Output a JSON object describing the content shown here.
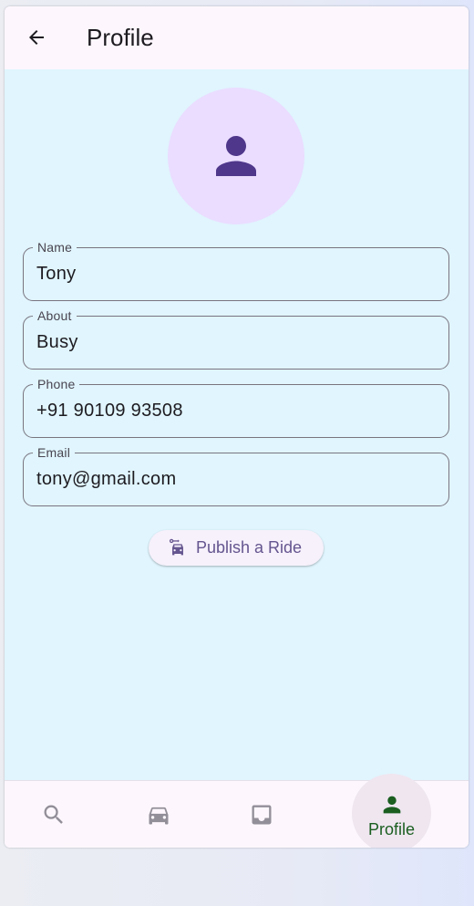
{
  "app_bar": {
    "title": "Profile"
  },
  "profile": {
    "fields": [
      {
        "label": "Name",
        "value": "Tony"
      },
      {
        "label": "About",
        "value": "Busy"
      },
      {
        "label": "Phone",
        "value": "+91 90109 93508"
      },
      {
        "label": "Email",
        "value": "tony@gmail.com"
      }
    ],
    "publish_button_label": "Publish a Ride"
  },
  "bottom_nav": {
    "items": [
      {
        "icon": "search-icon",
        "label": ""
      },
      {
        "icon": "car-icon",
        "label": ""
      },
      {
        "icon": "inbox-icon",
        "label": ""
      },
      {
        "icon": "person-icon",
        "label": "Profile",
        "active": true
      }
    ]
  },
  "colors": {
    "content_bg": "#e0f5fe",
    "surface": "#fdf7fd",
    "avatar_bg": "#eaddff",
    "primary": "#65558f",
    "avatar_icon": "#4f378b",
    "active_nav": "#1b5e20",
    "inactive_icon": "#938f99"
  }
}
